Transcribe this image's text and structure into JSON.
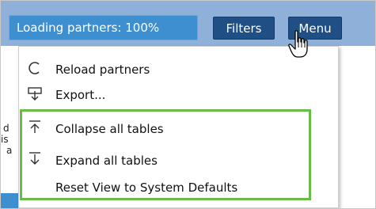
{
  "toolbar": {
    "loading_text": "Loading partners: 100%",
    "filters_label": "Filters",
    "menu_label": "Menu"
  },
  "background": {
    "fragments": [
      "d",
      "is",
      "a"
    ]
  },
  "menu": {
    "items": [
      {
        "icon": "reload-icon",
        "label": "Reload partners"
      },
      {
        "icon": "export-icon",
        "label": "Export..."
      },
      {
        "icon": "collapse-icon",
        "label": "Collapse all tables"
      },
      {
        "icon": "expand-icon",
        "label": "Expand all tables"
      },
      {
        "icon": "",
        "label": "Reset View to System Defaults"
      }
    ]
  },
  "colors": {
    "topbar": "#8fb1d9",
    "loading_pill": "#3d8fd0",
    "button": "#1f4f85",
    "highlight": "#67bd45"
  }
}
